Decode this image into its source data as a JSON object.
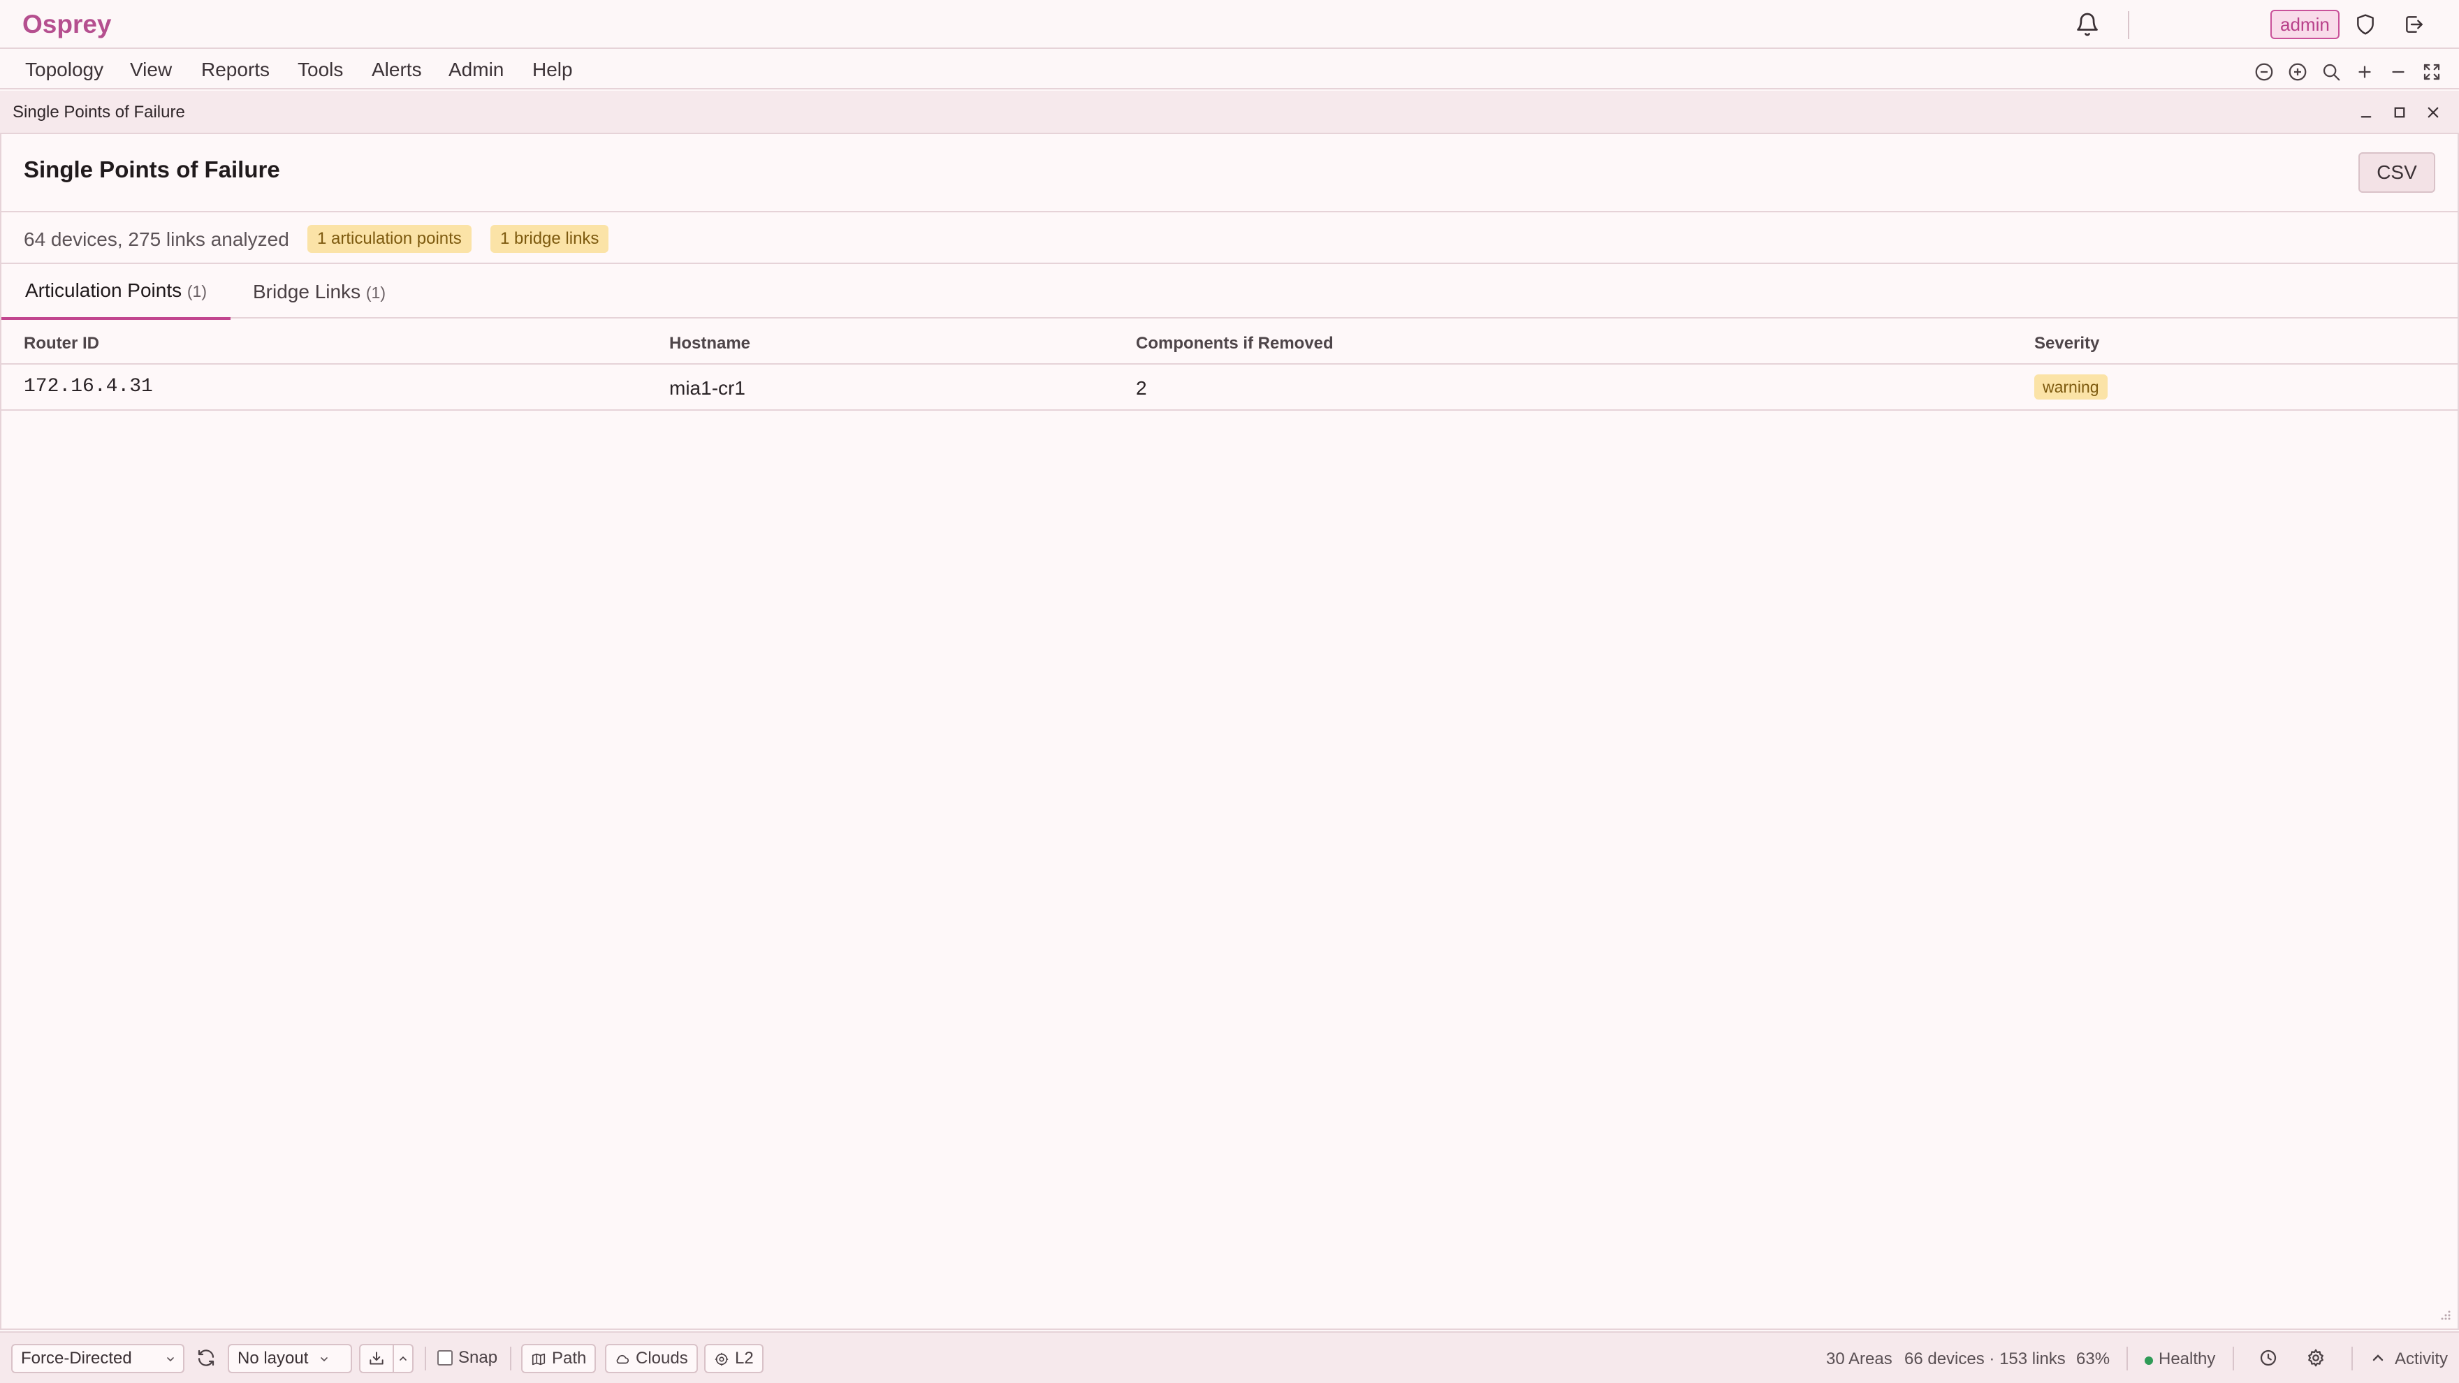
{
  "app": {
    "brand": "Osprey",
    "user_badge": "admin"
  },
  "menu": {
    "items": [
      "Topology",
      "View",
      "Reports",
      "Tools",
      "Alerts",
      "Admin",
      "Help"
    ]
  },
  "window": {
    "title": "Single Points of Failure"
  },
  "panel": {
    "title": "Single Points of Failure",
    "csv_label": "CSV",
    "summary": "64 devices, 275 links analyzed",
    "pill_articulation": "1 articulation points",
    "pill_bridge": "1 bridge links",
    "tabs": [
      {
        "label": "Articulation Points",
        "count": "(1)"
      },
      {
        "label": "Bridge Links",
        "count": "(1)"
      }
    ],
    "table": {
      "headers": [
        "Router ID",
        "Hostname",
        "Components if Removed",
        "Severity"
      ],
      "rows": [
        {
          "router_id": "172.16.4.31",
          "hostname": "mia1-cr1",
          "components": "2",
          "severity": "warning"
        }
      ]
    }
  },
  "statusbar": {
    "layout_algo": "Force-Directed",
    "saved_layout": "No layout",
    "snap_label": "Snap",
    "chip_path": "Path",
    "chip_clouds": "Clouds",
    "chip_l2": "L2",
    "areas": "30 Areas",
    "devices_links": "66 devices · 153 links",
    "zoom": "63%",
    "health": "Healthy",
    "activity": "Activity"
  },
  "colors": {
    "accent": "#b54f8f",
    "warning_bg": "#fbe3a7",
    "warning_text": "#7d5a0f",
    "healthy": "#2f9b57"
  }
}
